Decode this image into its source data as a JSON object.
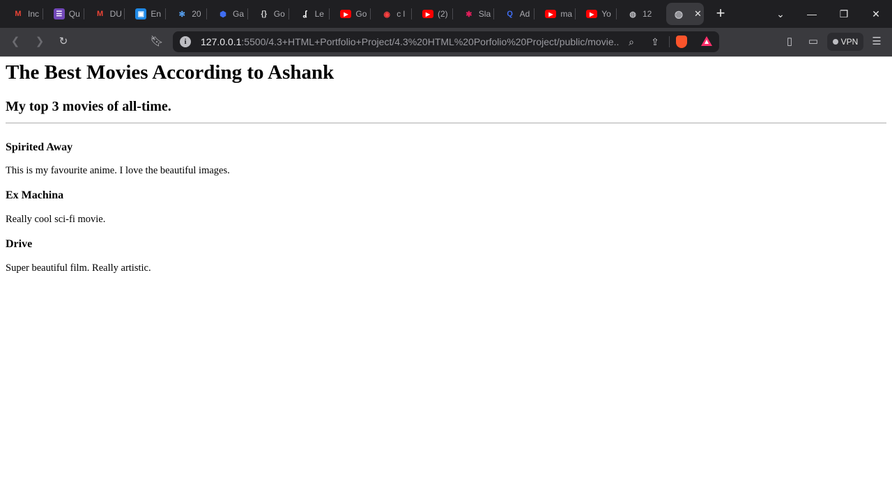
{
  "browser": {
    "tabs": [
      {
        "icon": "gmail-icon",
        "title": "Inc",
        "color": "#ea4335"
      },
      {
        "icon": "forms-icon",
        "title": "Qu",
        "color": "#7248b9"
      },
      {
        "icon": "gmail-icon",
        "title": "DU",
        "color": "#ea4335"
      },
      {
        "icon": "classroom-icon",
        "title": "En",
        "color": "#1e88e5"
      },
      {
        "icon": "atom-icon",
        "title": "20",
        "color": "#5aa9ff"
      },
      {
        "icon": "shield-icon",
        "title": "Ga",
        "color": "#3f6df2"
      },
      {
        "icon": "braces-icon",
        "title": "Go",
        "color": "#cfcfcf"
      },
      {
        "icon": "leetcode-icon",
        "title": "Le",
        "color": "#ffffff"
      },
      {
        "icon": "youtube-icon",
        "title": "Go",
        "color": "#ff0000"
      },
      {
        "icon": "record-icon",
        "title": "c l",
        "color": "#ff4040"
      },
      {
        "icon": "youtube-icon",
        "title": "(2)",
        "color": "#ff0000"
      },
      {
        "icon": "slack-icon",
        "title": "Sla",
        "color": "#e01e5a"
      },
      {
        "icon": "search-q-icon",
        "title": "Ad",
        "color": "#3f6df2"
      },
      {
        "icon": "youtube-icon",
        "title": "ma",
        "color": "#ff0000"
      },
      {
        "icon": "youtube-icon",
        "title": "Yo",
        "color": "#ff0000"
      },
      {
        "icon": "globe-icon",
        "title": "12",
        "color": "#bdbdc2"
      }
    ],
    "active_tab": {
      "icon": "globe-icon",
      "close_label": "✕"
    },
    "new_tab_label": "+",
    "url_host": "127.0.0.1",
    "url_rest": ":5500/4.3+HTML+Portfolio+Project/4.3%20HTML%20Porfolio%20Project/public/movie...",
    "vpn_label": "VPN"
  },
  "page": {
    "title": "The Best Movies According to Ashank",
    "subtitle": "My top 3 movies of all-time.",
    "movies": [
      {
        "title": "Spirited Away",
        "description": "This is my favourite anime. I love the beautiful images."
      },
      {
        "title": "Ex Machina",
        "description": "Really cool sci-fi movie."
      },
      {
        "title": "Drive",
        "description": "Super beautiful film. Really artistic."
      }
    ]
  }
}
